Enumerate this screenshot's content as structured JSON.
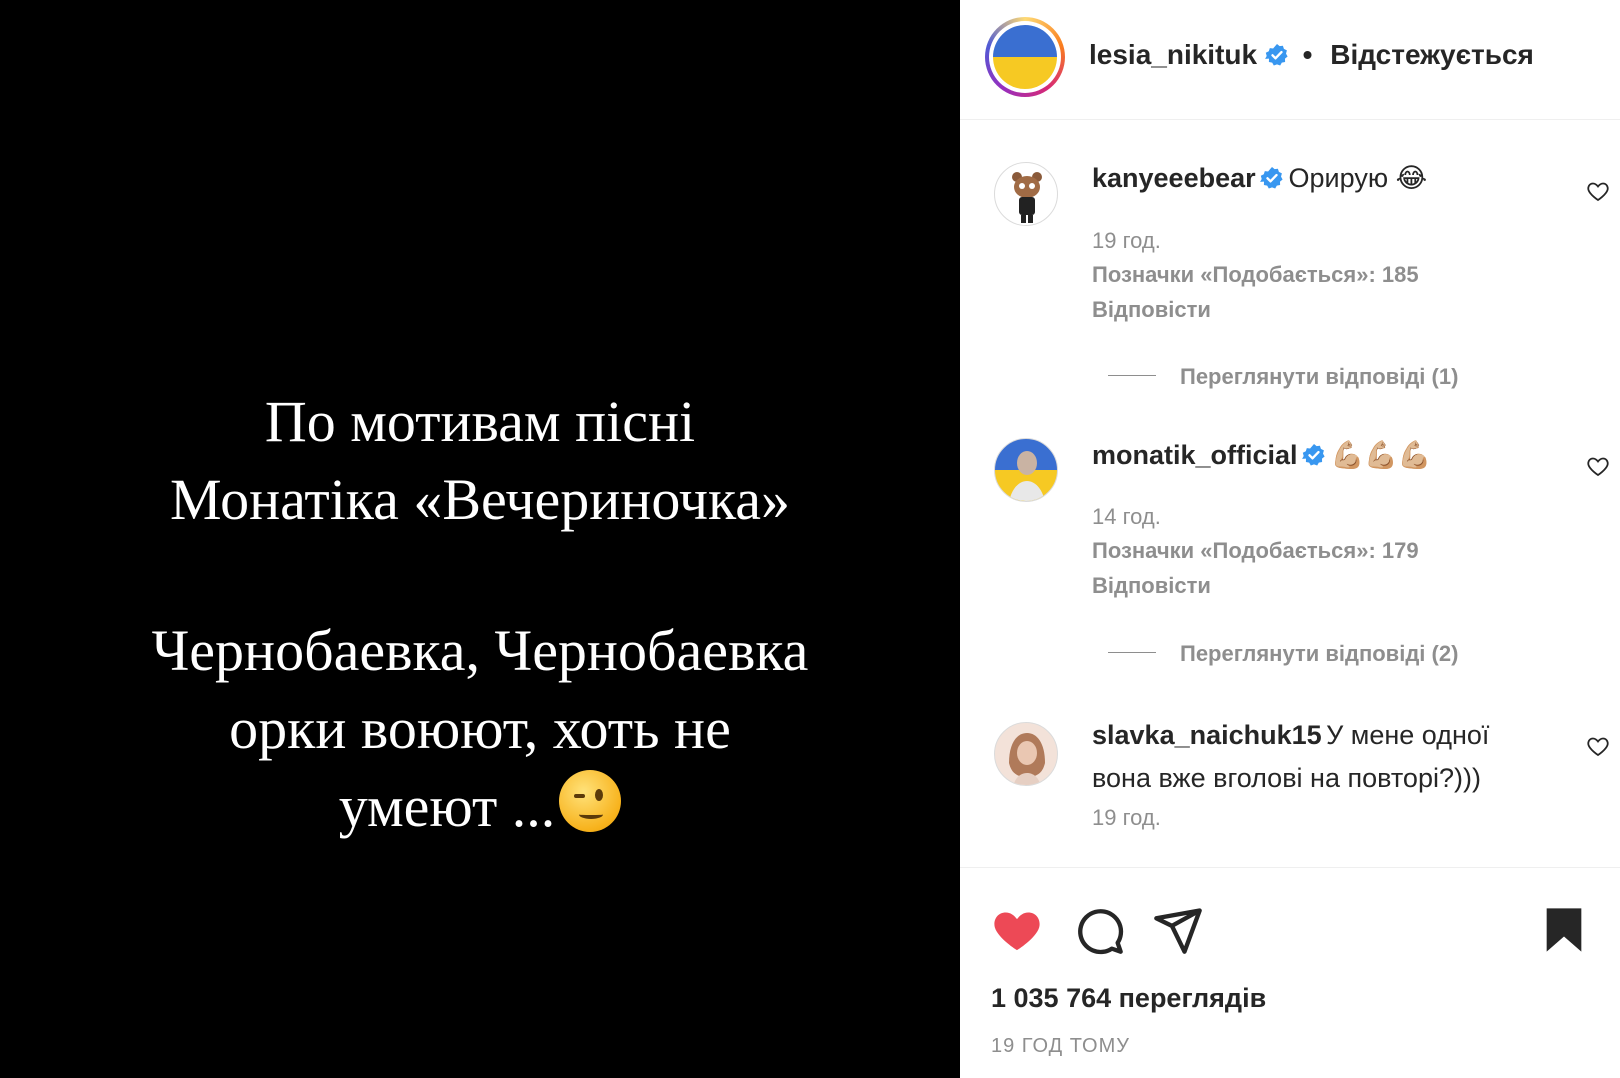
{
  "post": {
    "lines_block1": [
      "По мотивам пісні",
      "Монатіка «Вечериночка»"
    ],
    "lines_block2": [
      "Чернобаевка, Чернобаевка",
      "орки воюют, хоть не",
      "умеют ..."
    ],
    "emoji": "wink-emoji"
  },
  "header": {
    "username": "lesia_nikituk",
    "separator": "•",
    "follow_state": "Відстежується",
    "avatar_icon": "ukraine-flag-avatar",
    "more_icon": "more-options-icon"
  },
  "comments": [
    {
      "author": "kanyeeebear",
      "verified": true,
      "text": "Орирую 😂",
      "time": "19 год.",
      "likes_label": "Позначки «Подобається»: 185",
      "reply_label": "Відповісти",
      "view_replies": "Переглянути відповіді (1)"
    },
    {
      "author": "monatik_official",
      "verified": true,
      "text": "💪🏼💪🏼💪🏼",
      "time": "14 год.",
      "likes_label": "Позначки «Подобається»: 179",
      "reply_label": "Відповісти",
      "view_replies": "Переглянути відповіді (2)"
    },
    {
      "author": "slavka_naichuk15",
      "verified": false,
      "text": "У мене одної вона вже вголові на повторі?)))",
      "time": "19 год."
    }
  ],
  "footer": {
    "views": "1 035 764 переглядів",
    "time_ago": "19 ГОД ТОМУ",
    "liked": true,
    "saved": true
  },
  "colors": {
    "like_red": "#ed4956",
    "verified_blue": "#3897f0",
    "muted": "#8e8e8e"
  }
}
